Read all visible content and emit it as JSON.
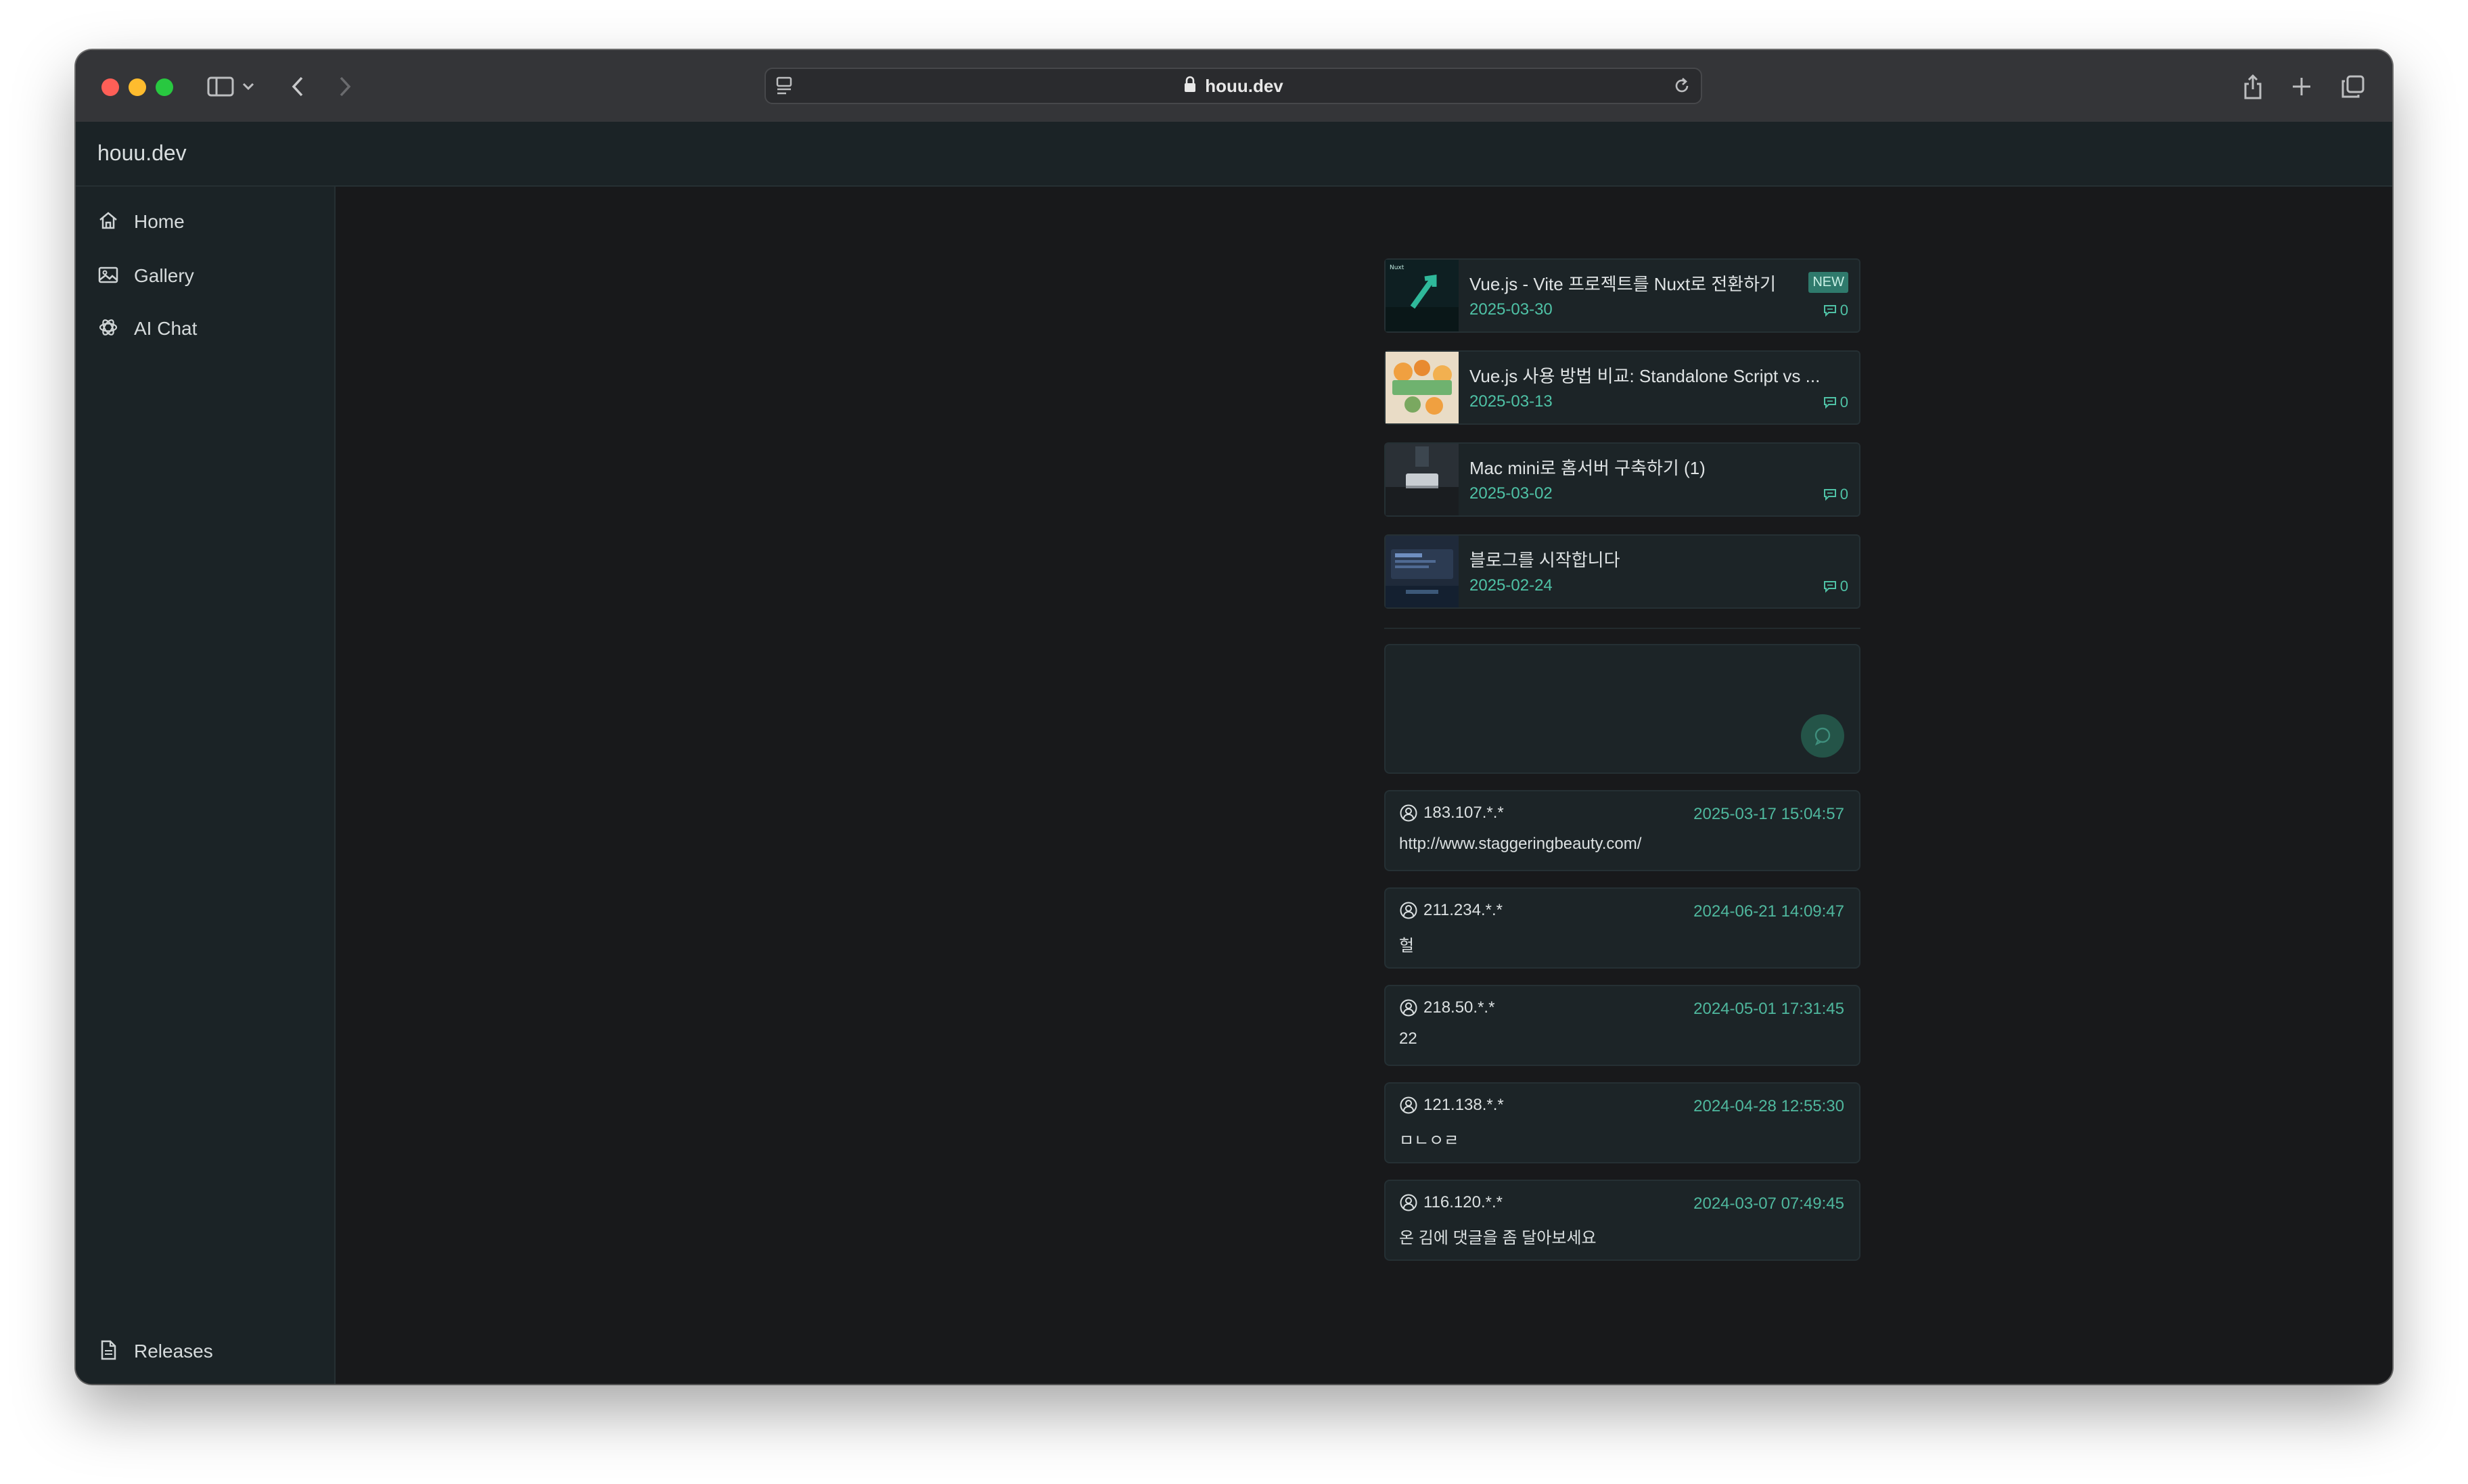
{
  "browser": {
    "url": "houu.dev"
  },
  "site": {
    "title": "houu.dev"
  },
  "sidebar": {
    "items": [
      {
        "label": "Home",
        "icon": "home-icon"
      },
      {
        "label": "Gallery",
        "icon": "image-icon"
      },
      {
        "label": "AI Chat",
        "icon": "openai-icon"
      }
    ],
    "footer": {
      "label": "Releases",
      "icon": "document-icon"
    }
  },
  "posts": [
    {
      "title": "Vue.js - Vite 프로젝트를 Nuxt로 전환하기",
      "date": "2025-03-30",
      "comments": "0",
      "badge": "NEW",
      "thumb_label": "Nuxt"
    },
    {
      "title": "Vue.js 사용 방법 비교: Standalone Script vs ...",
      "date": "2025-03-13",
      "comments": "0"
    },
    {
      "title": "Mac mini로 홈서버 구축하기 (1)",
      "date": "2025-03-02",
      "comments": "0"
    },
    {
      "title": "블로그를 시작합니다",
      "date": "2025-02-24",
      "comments": "0"
    }
  ],
  "comment_form": {
    "placeholder": ""
  },
  "comments": [
    {
      "user": "183.107.*.*",
      "time": "2025-03-17 15:04:57",
      "text": "http://www.staggeringbeauty.com/"
    },
    {
      "user": "211.234.*.*",
      "time": "2024-06-21 14:09:47",
      "text": "헐"
    },
    {
      "user": "218.50.*.*",
      "time": "2024-05-01 17:31:45",
      "text": "22"
    },
    {
      "user": "121.138.*.*",
      "time": "2024-04-28 12:55:30",
      "text": "ㅁㄴㅇㄹ"
    },
    {
      "user": "116.120.*.*",
      "time": "2024-03-07 07:49:45",
      "text": "온 김에 댓글을 좀 달아보세요"
    }
  ],
  "colors": {
    "accent": "#4fc2a6",
    "background": "#18191b",
    "panel": "#1b2326"
  }
}
